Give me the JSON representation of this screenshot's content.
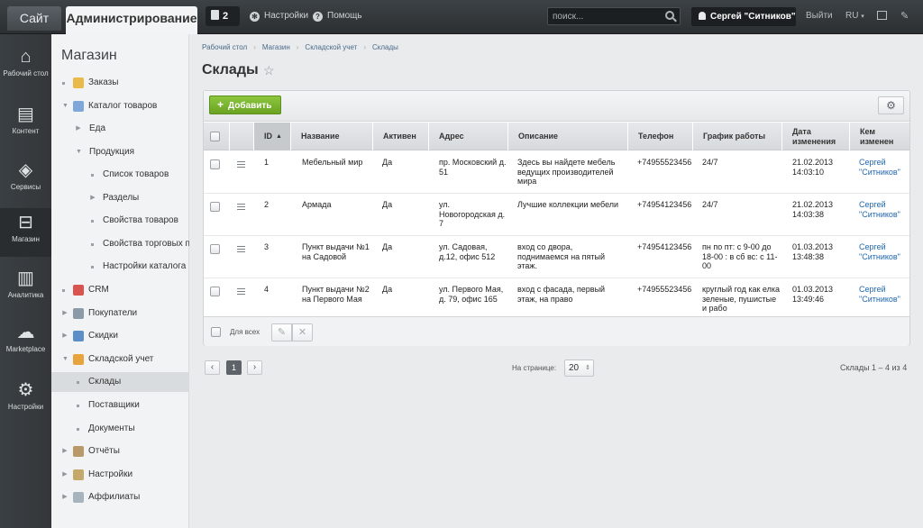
{
  "topbar": {
    "site_tab": "Сайт",
    "admin_tab": "Администрирование",
    "notifications_count": "2",
    "settings": "Настройки",
    "help": "Помощь",
    "search_placeholder": "поиск...",
    "user_name": "Сергей \"Ситников\"",
    "logout": "Выйти",
    "lang": "RU"
  },
  "iconbar": {
    "items": [
      {
        "label": "Рабочий стол",
        "icon": "home-icon"
      },
      {
        "label": "Контент",
        "icon": "document-icon"
      },
      {
        "label": "Сервисы",
        "icon": "layers-icon"
      },
      {
        "label": "Магазин",
        "icon": "basket-icon"
      },
      {
        "label": "Аналитика",
        "icon": "chart-icon"
      },
      {
        "label": "Marketplace",
        "icon": "cloud-download-icon"
      },
      {
        "label": "Настройки",
        "icon": "gear-icon"
      }
    ]
  },
  "menu": {
    "title": "Магазин",
    "items": [
      {
        "label": "Заказы"
      },
      {
        "label": "Каталог товаров"
      },
      {
        "label": "Еда"
      },
      {
        "label": "Продукция"
      },
      {
        "label": "Список товаров"
      },
      {
        "label": "Разделы"
      },
      {
        "label": "Свойства товаров"
      },
      {
        "label": "Свойства торговых пр"
      },
      {
        "label": "Настройки каталога"
      },
      {
        "label": "CRM"
      },
      {
        "label": "Покупатели"
      },
      {
        "label": "Скидки"
      },
      {
        "label": "Складской учет"
      },
      {
        "label": "Склады"
      },
      {
        "label": "Поставщики"
      },
      {
        "label": "Документы"
      },
      {
        "label": "Отчёты"
      },
      {
        "label": "Настройки"
      },
      {
        "label": "Аффилиаты"
      }
    ]
  },
  "breadcrumb": [
    "Рабочий стол",
    "Магазин",
    "Складской учет",
    "Склады"
  ],
  "page_title": "Склады",
  "toolbar": {
    "add_label": "Добавить"
  },
  "table": {
    "columns": [
      "ID",
      "Название",
      "Активен",
      "Адрес",
      "Описание",
      "Телефон",
      "График работы",
      "Дата изменения",
      "Кем изменен"
    ],
    "rows": [
      {
        "id": "1",
        "name": "Мебельный мир",
        "active": "Да",
        "address": "пр. Московский д. 51",
        "description": "Здесь вы найдете мебель ведущих производителей мира",
        "phone": "+74955523456",
        "schedule": "24/7",
        "date": "21.02.2013 14:03:10",
        "user": "Сергей \"Ситников\""
      },
      {
        "id": "2",
        "name": "Армада",
        "active": "Да",
        "address": "ул. Новогородская д. 7",
        "description": "Лучшие коллекции мебели",
        "phone": "+74954123456",
        "schedule": "24/7",
        "date": "21.02.2013 14:03:38",
        "user": "Сергей \"Ситников\""
      },
      {
        "id": "3",
        "name": "Пункт выдачи №1 на Садовой",
        "active": "Да",
        "address": "ул. Садовая, д.12, офис 512",
        "description": "вход со двора, поднимаемся на пятый этаж.",
        "phone": "+74954123456",
        "schedule": "пн по пт: с 9-00 до 18-00 : в сб вс: с 11-00",
        "date": "01.03.2013 13:48:38",
        "user": "Сергей \"Ситников\""
      },
      {
        "id": "4",
        "name": "Пункт выдачи №2 на Первого Мая",
        "active": "Да",
        "address": "ул. Первого Мая, д. 79, офис 165",
        "description": "вход с фасада, первый этаж, на право",
        "phone": "+74955523456",
        "schedule": "круглый год как елка зеленые, пушистые и рабо",
        "date": "01.03.2013 13:49:46",
        "user": "Сергей \"Ситников\""
      }
    ],
    "for_all_label": "Для всех"
  },
  "pagination": {
    "current_page": "1",
    "per_page_label": "На странице:",
    "per_page_value": "20",
    "count_text": "Склады 1 – 4 из 4"
  }
}
